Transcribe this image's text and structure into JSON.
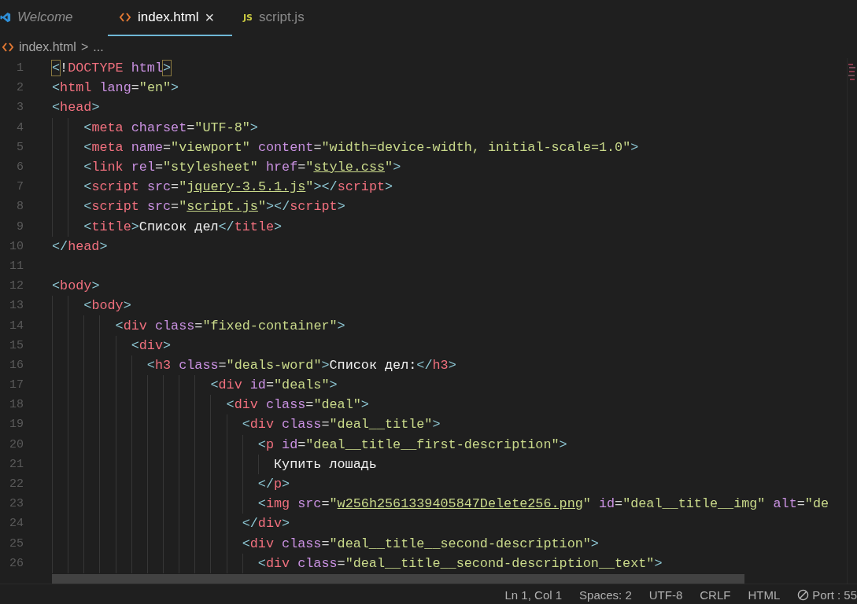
{
  "tabs": [
    {
      "label": "Welcome",
      "kind": "vscode",
      "selected": false,
      "preview": true
    },
    {
      "label": "index.html",
      "kind": "html",
      "selected": true,
      "preview": false,
      "close": "×"
    },
    {
      "label": "script.js",
      "kind": "js",
      "selected": false,
      "preview": false,
      "badge": "JS"
    }
  ],
  "breadcrumb": {
    "file": "index.html",
    "separator": ">",
    "more": "..."
  },
  "lines": [
    {
      "number": "1",
      "tokens": [
        {
          "kind": "match",
          "text": "<"
        },
        {
          "kind": "text",
          "text": "!"
        },
        {
          "kind": "tag",
          "text": "DOCTYPE"
        },
        {
          "kind": "attr",
          "text": " html"
        },
        {
          "kind": "match",
          "text": ">"
        }
      ]
    },
    {
      "number": "2",
      "tokens": [
        {
          "kind": "p",
          "text": "<"
        },
        {
          "kind": "tag",
          "text": "html"
        },
        {
          "kind": "attr",
          "text": " lang"
        },
        {
          "kind": "eq",
          "text": "="
        },
        {
          "kind": "str",
          "text": "\"en\""
        },
        {
          "kind": "p",
          "text": ">"
        }
      ]
    },
    {
      "number": "3",
      "tokens": [
        {
          "kind": "p",
          "text": "<"
        },
        {
          "kind": "tag",
          "text": "head"
        },
        {
          "kind": "p",
          "text": ">"
        }
      ]
    },
    {
      "number": "4",
      "tokens": [
        {
          "kind": "p",
          "text": "    <"
        },
        {
          "kind": "tag",
          "text": "meta"
        },
        {
          "kind": "attr",
          "text": " charset"
        },
        {
          "kind": "eq",
          "text": "="
        },
        {
          "kind": "str",
          "text": "\"UTF-8\""
        },
        {
          "kind": "p",
          "text": ">"
        }
      ]
    },
    {
      "number": "5",
      "tokens": [
        {
          "kind": "p",
          "text": "    <"
        },
        {
          "kind": "tag",
          "text": "meta"
        },
        {
          "kind": "attr",
          "text": " name"
        },
        {
          "kind": "eq",
          "text": "="
        },
        {
          "kind": "str",
          "text": "\"viewport\""
        },
        {
          "kind": "attr",
          "text": " content"
        },
        {
          "kind": "eq",
          "text": "="
        },
        {
          "kind": "str",
          "text": "\"width=device-width, initial-scale=1.0\""
        },
        {
          "kind": "p",
          "text": ">"
        }
      ]
    },
    {
      "number": "6",
      "tokens": [
        {
          "kind": "p",
          "text": "    <"
        },
        {
          "kind": "tag",
          "text": "link"
        },
        {
          "kind": "attr",
          "text": " rel"
        },
        {
          "kind": "eq",
          "text": "="
        },
        {
          "kind": "str",
          "text": "\"stylesheet\""
        },
        {
          "kind": "attr",
          "text": " href"
        },
        {
          "kind": "eq",
          "text": "="
        },
        {
          "kind": "str",
          "text": "\""
        },
        {
          "kind": "link",
          "text": "style.css"
        },
        {
          "kind": "str",
          "text": "\""
        },
        {
          "kind": "p",
          "text": ">"
        }
      ]
    },
    {
      "number": "7",
      "tokens": [
        {
          "kind": "p",
          "text": "    <"
        },
        {
          "kind": "tag",
          "text": "script"
        },
        {
          "kind": "attr",
          "text": " src"
        },
        {
          "kind": "eq",
          "text": "="
        },
        {
          "kind": "str",
          "text": "\""
        },
        {
          "kind": "link",
          "text": "jquery-3.5.1.js"
        },
        {
          "kind": "str",
          "text": "\""
        },
        {
          "kind": "p",
          "text": "></"
        },
        {
          "kind": "tag",
          "text": "script"
        },
        {
          "kind": "p",
          "text": ">"
        }
      ]
    },
    {
      "number": "8",
      "tokens": [
        {
          "kind": "p",
          "text": "    <"
        },
        {
          "kind": "tag",
          "text": "script"
        },
        {
          "kind": "attr",
          "text": " src"
        },
        {
          "kind": "eq",
          "text": "="
        },
        {
          "kind": "str",
          "text": "\""
        },
        {
          "kind": "link",
          "text": "script.js"
        },
        {
          "kind": "str",
          "text": "\""
        },
        {
          "kind": "p",
          "text": "></"
        },
        {
          "kind": "tag",
          "text": "script"
        },
        {
          "kind": "p",
          "text": ">"
        }
      ]
    },
    {
      "number": "9",
      "tokens": [
        {
          "kind": "p",
          "text": "    <"
        },
        {
          "kind": "tag",
          "text": "title"
        },
        {
          "kind": "p",
          "text": ">"
        },
        {
          "kind": "text",
          "text": "Список дел"
        },
        {
          "kind": "p",
          "text": "</"
        },
        {
          "kind": "tag",
          "text": "title"
        },
        {
          "kind": "p",
          "text": ">"
        }
      ]
    },
    {
      "number": "10",
      "tokens": [
        {
          "kind": "p",
          "text": "</"
        },
        {
          "kind": "tag",
          "text": "head"
        },
        {
          "kind": "p",
          "text": ">"
        }
      ]
    },
    {
      "number": "11"
    },
    {
      "number": "12",
      "tokens": [
        {
          "kind": "p",
          "text": "<"
        },
        {
          "kind": "tag",
          "text": "body"
        },
        {
          "kind": "p",
          "text": ">"
        }
      ]
    },
    {
      "number": "13",
      "tokens": [
        {
          "kind": "p",
          "text": "    <"
        },
        {
          "kind": "tag",
          "text": "body"
        },
        {
          "kind": "p",
          "text": ">"
        }
      ]
    },
    {
      "number": "14",
      "tokens": [
        {
          "kind": "p",
          "text": "        <"
        },
        {
          "kind": "tag",
          "text": "div"
        },
        {
          "kind": "attr",
          "text": " class"
        },
        {
          "kind": "eq",
          "text": "="
        },
        {
          "kind": "str",
          "text": "\"fixed-container\""
        },
        {
          "kind": "p",
          "text": ">"
        }
      ]
    },
    {
      "number": "15",
      "tokens": [
        {
          "kind": "p",
          "text": "          <"
        },
        {
          "kind": "tag",
          "text": "div"
        },
        {
          "kind": "p",
          "text": ">"
        }
      ]
    },
    {
      "number": "16",
      "tokens": [
        {
          "kind": "p",
          "text": "            <"
        },
        {
          "kind": "tag",
          "text": "h3"
        },
        {
          "kind": "attr",
          "text": " class"
        },
        {
          "kind": "eq",
          "text": "="
        },
        {
          "kind": "str",
          "text": "\"deals-word\""
        },
        {
          "kind": "p",
          "text": ">"
        },
        {
          "kind": "text",
          "text": "Список дел:"
        },
        {
          "kind": "p",
          "text": "</"
        },
        {
          "kind": "tag",
          "text": "h3"
        },
        {
          "kind": "p",
          "text": ">"
        }
      ]
    },
    {
      "number": "17",
      "tokens": [
        {
          "kind": "p",
          "text": "                    <"
        },
        {
          "kind": "tag",
          "text": "div"
        },
        {
          "kind": "attr",
          "text": " id"
        },
        {
          "kind": "eq",
          "text": "="
        },
        {
          "kind": "str",
          "text": "\"deals\""
        },
        {
          "kind": "p",
          "text": ">"
        }
      ]
    },
    {
      "number": "18",
      "tokens": [
        {
          "kind": "p",
          "text": "                      <"
        },
        {
          "kind": "tag",
          "text": "div"
        },
        {
          "kind": "attr",
          "text": " class"
        },
        {
          "kind": "eq",
          "text": "="
        },
        {
          "kind": "str",
          "text": "\"deal\""
        },
        {
          "kind": "p",
          "text": ">"
        }
      ]
    },
    {
      "number": "19",
      "tokens": [
        {
          "kind": "p",
          "text": "                        <"
        },
        {
          "kind": "tag",
          "text": "div"
        },
        {
          "kind": "attr",
          "text": " class"
        },
        {
          "kind": "eq",
          "text": "="
        },
        {
          "kind": "str",
          "text": "\"deal__title\""
        },
        {
          "kind": "p",
          "text": ">"
        }
      ]
    },
    {
      "number": "20",
      "tokens": [
        {
          "kind": "p",
          "text": "                          <"
        },
        {
          "kind": "tag",
          "text": "p"
        },
        {
          "kind": "attr",
          "text": " id"
        },
        {
          "kind": "eq",
          "text": "="
        },
        {
          "kind": "str",
          "text": "\"deal__title__first-description\""
        },
        {
          "kind": "p",
          "text": ">"
        }
      ]
    },
    {
      "number": "21",
      "tokens": [
        {
          "kind": "text",
          "text": "                            Купить лошадь"
        }
      ]
    },
    {
      "number": "22",
      "tokens": [
        {
          "kind": "p",
          "text": "                          </"
        },
        {
          "kind": "tag",
          "text": "p"
        },
        {
          "kind": "p",
          "text": ">"
        }
      ]
    },
    {
      "number": "23",
      "tokens": [
        {
          "kind": "p",
          "text": "                          <"
        },
        {
          "kind": "tag",
          "text": "img"
        },
        {
          "kind": "attr",
          "text": " src"
        },
        {
          "kind": "eq",
          "text": "="
        },
        {
          "kind": "str",
          "text": "\""
        },
        {
          "kind": "link",
          "text": "w256h2561339405847Delete256.png"
        },
        {
          "kind": "str",
          "text": "\""
        },
        {
          "kind": "attr",
          "text": " id"
        },
        {
          "kind": "eq",
          "text": "="
        },
        {
          "kind": "str",
          "text": "\"deal__title__img\""
        },
        {
          "kind": "attr",
          "text": " alt"
        },
        {
          "kind": "eq",
          "text": "="
        },
        {
          "kind": "str",
          "text": "\"de"
        }
      ]
    },
    {
      "number": "24",
      "tokens": [
        {
          "kind": "p",
          "text": "                        </"
        },
        {
          "kind": "tag",
          "text": "div"
        },
        {
          "kind": "p",
          "text": ">"
        }
      ]
    },
    {
      "number": "25",
      "tokens": [
        {
          "kind": "p",
          "text": "                        <"
        },
        {
          "kind": "tag",
          "text": "div"
        },
        {
          "kind": "attr",
          "text": " class"
        },
        {
          "kind": "eq",
          "text": "="
        },
        {
          "kind": "str",
          "text": "\"deal__title__second-description\""
        },
        {
          "kind": "p",
          "text": ">"
        }
      ]
    },
    {
      "number": "26",
      "tokens": [
        {
          "kind": "p",
          "text": "                          <"
        },
        {
          "kind": "tag",
          "text": "div"
        },
        {
          "kind": "attr",
          "text": " class"
        },
        {
          "kind": "eq",
          "text": "="
        },
        {
          "kind": "str",
          "text": "\"deal__title__second-description__text\""
        },
        {
          "kind": "p",
          "text": ">"
        }
      ]
    }
  ],
  "status_bar": [
    {
      "kind": "text",
      "label": "Ln 1, Col 1"
    },
    {
      "kind": "text",
      "label": "Spaces: 2"
    },
    {
      "kind": "text",
      "label": "UTF-8"
    },
    {
      "kind": "text",
      "label": "CRLF"
    },
    {
      "kind": "text",
      "label": "HTML"
    },
    {
      "kind": "port",
      "label": "Port : 55"
    }
  ]
}
